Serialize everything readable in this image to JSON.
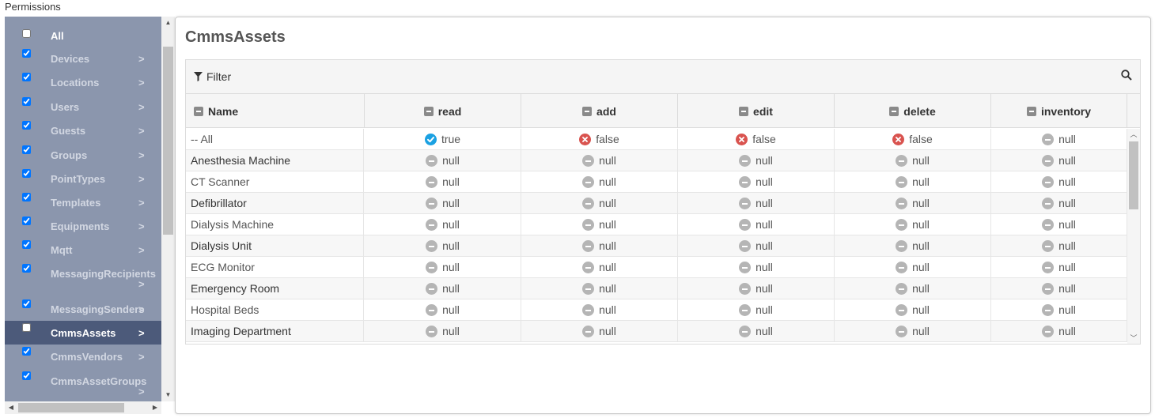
{
  "page_label": "Permissions",
  "sidebar": {
    "items": [
      {
        "label": "All",
        "checked": false,
        "arrow": ""
      },
      {
        "label": "Devices",
        "checked": true,
        "arrow": ">"
      },
      {
        "label": "Locations",
        "checked": true,
        "arrow": ">"
      },
      {
        "label": "Users",
        "checked": true,
        "arrow": ">"
      },
      {
        "label": "Guests",
        "checked": true,
        "arrow": ">"
      },
      {
        "label": "Groups",
        "checked": true,
        "arrow": ">"
      },
      {
        "label": "PointTypes",
        "checked": true,
        "arrow": ">"
      },
      {
        "label": "Templates",
        "checked": true,
        "arrow": ">"
      },
      {
        "label": "Equipments",
        "checked": true,
        "arrow": ">"
      },
      {
        "label": "Mqtt",
        "checked": true,
        "arrow": ">"
      },
      {
        "label": "MessagingRecipients",
        "checked": true,
        "arrow": ">"
      },
      {
        "label": "MessagingSenders",
        "checked": true,
        "arrow": ">"
      },
      {
        "label": "CmmsAssets",
        "checked": false,
        "arrow": ">",
        "active": true
      },
      {
        "label": "CmmsVendors",
        "checked": true,
        "arrow": ">"
      },
      {
        "label": "CmmsAssetGroups",
        "checked": true,
        "arrow": ">"
      }
    ]
  },
  "panel": {
    "title": "CmmsAssets",
    "filter_label": "Filter",
    "columns": [
      "Name",
      "read",
      "add",
      "edit",
      "delete",
      "inventory"
    ],
    "rows": [
      {
        "name": "-- All",
        "values": [
          "true",
          "false",
          "false",
          "false",
          "null"
        ]
      },
      {
        "name": "Anesthesia Machine",
        "values": [
          "null",
          "null",
          "null",
          "null",
          "null"
        ]
      },
      {
        "name": "CT Scanner",
        "values": [
          "null",
          "null",
          "null",
          "null",
          "null"
        ]
      },
      {
        "name": "Defibrillator",
        "values": [
          "null",
          "null",
          "null",
          "null",
          "null"
        ]
      },
      {
        "name": "Dialysis Machine",
        "values": [
          "null",
          "null",
          "null",
          "null",
          "null"
        ]
      },
      {
        "name": "Dialysis Unit",
        "values": [
          "null",
          "null",
          "null",
          "null",
          "null"
        ]
      },
      {
        "name": "ECG Monitor",
        "values": [
          "null",
          "null",
          "null",
          "null",
          "null"
        ]
      },
      {
        "name": "Emergency Room",
        "values": [
          "null",
          "null",
          "null",
          "null",
          "null"
        ]
      },
      {
        "name": "Hospital Beds",
        "values": [
          "null",
          "null",
          "null",
          "null",
          "null"
        ]
      },
      {
        "name": "Imaging Department",
        "values": [
          "null",
          "null",
          "null",
          "null",
          "null"
        ]
      }
    ]
  },
  "icons": {
    "filter": "filter-icon",
    "search": "search-icon",
    "true": "check-circle-icon",
    "false": "x-circle-icon",
    "null": "minus-circle-icon"
  },
  "colors": {
    "sidebar_bg": "#8b96ad",
    "sidebar_active": "#4c5a7a",
    "true_icon": "#1ba1e2",
    "false_icon": "#d9534f",
    "null_icon": "#b5b5b5"
  }
}
